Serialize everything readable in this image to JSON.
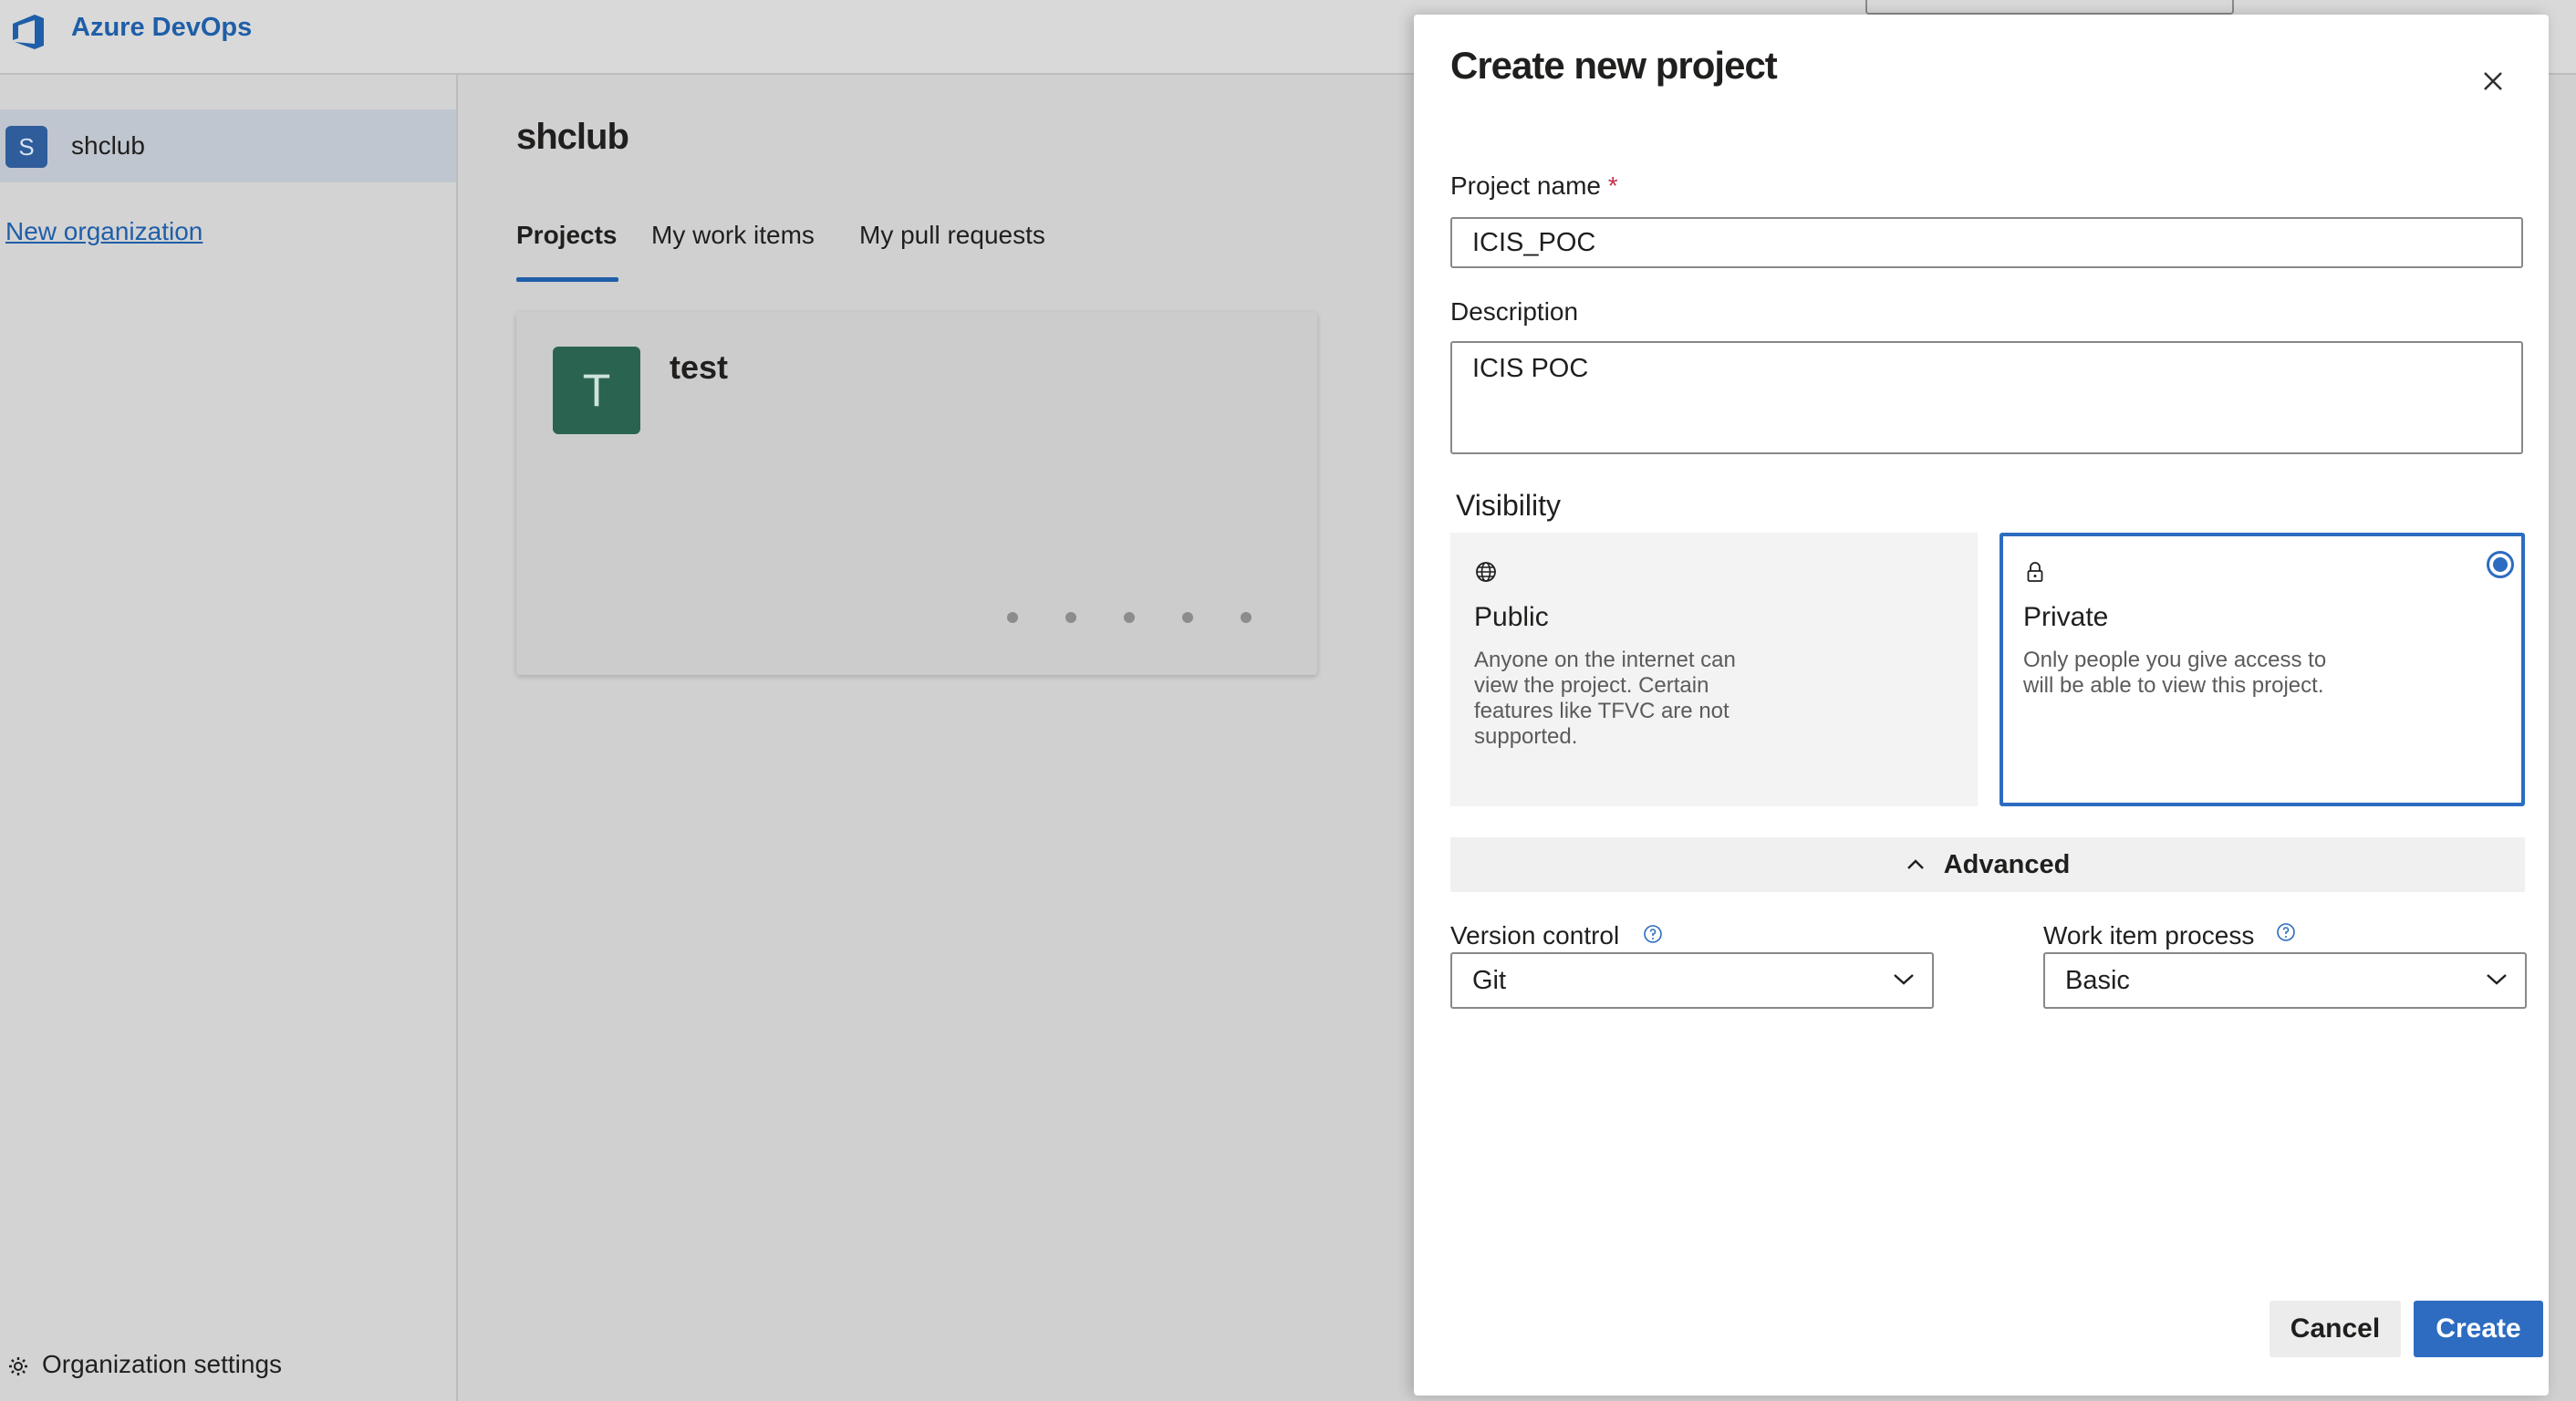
{
  "app": {
    "brand": "Azure DevOps"
  },
  "sidebar": {
    "org": {
      "initial": "S",
      "name": "shclub"
    },
    "new_org_label": "New organization",
    "settings_label": "Organization settings"
  },
  "main": {
    "title": "shclub",
    "tabs": [
      {
        "label": "Projects",
        "active": true
      },
      {
        "label": "My work items",
        "active": false
      },
      {
        "label": "My pull requests",
        "active": false
      }
    ],
    "project_card": {
      "initial": "T",
      "name": "test"
    }
  },
  "dialog": {
    "title": "Create new project",
    "project_name": {
      "label": "Project name",
      "required_mark": "*",
      "value": "ICIS_POC"
    },
    "description": {
      "label": "Description",
      "value": "ICIS POC"
    },
    "visibility": {
      "label": "Visibility",
      "selected": "private",
      "options": [
        {
          "id": "public",
          "icon": "globe-icon",
          "title": "Public",
          "description": "Anyone on the internet can view the project. Certain features like TFVC are not supported."
        },
        {
          "id": "private",
          "icon": "lock-icon",
          "title": "Private",
          "description": "Only people you give access to will be able to view this project."
        }
      ]
    },
    "advanced_label": "Advanced",
    "version_control": {
      "label": "Version control",
      "value": "Git"
    },
    "work_item_process": {
      "label": "Work item process",
      "value": "Basic"
    },
    "cancel_label": "Cancel",
    "create_label": "Create"
  },
  "colors": {
    "accent": "#2d6cc0",
    "brand": "#1f5ea8",
    "project_avatar": "#2a6450"
  }
}
